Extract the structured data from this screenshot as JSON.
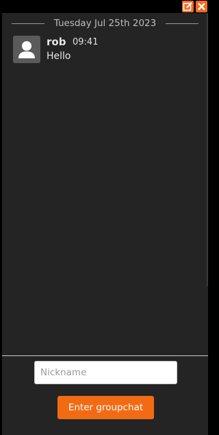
{
  "header": {
    "buttons": [
      {
        "icon": "edit-icon"
      },
      {
        "icon": "close-icon"
      }
    ],
    "accent_color": "#f26b21"
  },
  "chat": {
    "date_separator": "Tuesday Jul 25th 2023",
    "messages": [
      {
        "author": "rob",
        "time": "09:41",
        "text": "Hello",
        "avatar_icon": "user-avatar-icon"
      }
    ]
  },
  "join_form": {
    "nickname_placeholder": "Nickname",
    "nickname_value": "",
    "enter_label": "Enter groupchat"
  }
}
